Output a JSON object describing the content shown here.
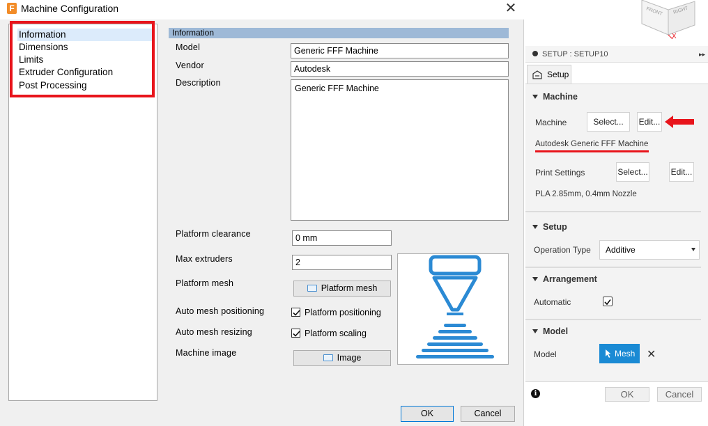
{
  "dialog": {
    "app_icon_letter": "F",
    "title": "Machine Configuration",
    "close_glyph": "✕",
    "nav_items": [
      "Information",
      "Dimensions",
      "Limits",
      "Extruder Configuration",
      "Post Processing"
    ],
    "section_header": "Information",
    "fields": {
      "model_label": "Model",
      "model_value": "Generic FFF Machine",
      "vendor_label": "Vendor",
      "vendor_value": "Autodesk",
      "description_label": "Description",
      "description_value": "Generic FFF Machine",
      "platform_clearance_label": "Platform clearance",
      "platform_clearance_value": "0 mm",
      "max_extruders_label": "Max extruders",
      "max_extruders_value": "2",
      "platform_mesh_label": "Platform mesh",
      "platform_mesh_button": "Platform mesh",
      "auto_mesh_positioning_label": "Auto mesh positioning",
      "platform_positioning_checkbox": "Platform positioning",
      "auto_mesh_resizing_label": "Auto mesh resizing",
      "platform_scaling_checkbox": "Platform scaling",
      "machine_image_label": "Machine image",
      "image_button": "Image"
    },
    "ok_label": "OK",
    "cancel_label": "Cancel"
  },
  "setup_panel": {
    "header": "SETUP : SETUP10",
    "tab": "Setup",
    "machine_section": "Machine",
    "machine_label": "Machine",
    "select_label": "Select...",
    "edit_label": "Edit...",
    "machine_name": "Autodesk Generic FFF Machine",
    "print_settings_label": "Print Settings",
    "print_settings_value": "PLA 2.85mm, 0.4mm Nozzle",
    "setup_section": "Setup",
    "operation_type_label": "Operation Type",
    "operation_type_value": "Additive",
    "arrangement_section": "Arrangement",
    "automatic_label": "Automatic",
    "model_section": "Model",
    "model_label": "Model",
    "mesh_button": "Mesh",
    "ok_label": "OK",
    "cancel_label": "Cancel"
  },
  "viewcube": {
    "front": "FRONT",
    "right": "RIGHT",
    "axis": "X"
  },
  "colors": {
    "annotation_red": "#e8141b",
    "accent_blue": "#1a8ad4",
    "section_header": "#9eb9d7",
    "illustration_blue": "#2b8ad4"
  }
}
